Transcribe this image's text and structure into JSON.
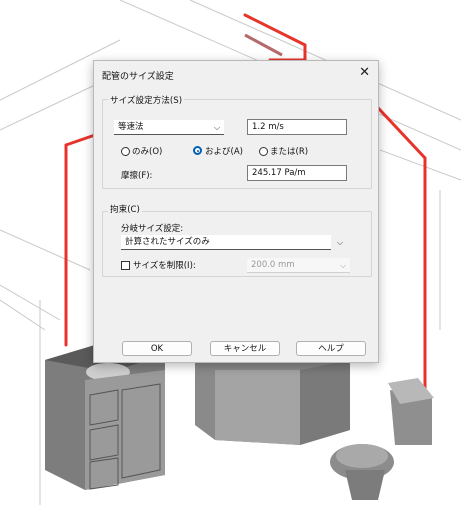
{
  "dialog": {
    "title": "配管のサイズ設定",
    "close_icon": "close-icon"
  },
  "sizing": {
    "legend": "サイズ設定方法(S)",
    "method_value": "等速法",
    "velocity_value": "1.2 m/s",
    "radio_only": "のみ(O)",
    "radio_and": "および(A)",
    "radio_or": "または(R)",
    "selected_radio": "and",
    "friction_label": "摩擦(F):",
    "friction_value": "245.17 Pa/m"
  },
  "constraints": {
    "legend": "拘束(C)",
    "branch_label": "分岐サイズ設定:",
    "branch_value": "計算されたサイズのみ",
    "restrict_label": "サイズを制限(I):",
    "restrict_checked": false,
    "restrict_value": "200.0 mm"
  },
  "buttons": {
    "ok": "OK",
    "cancel": "キャンセル",
    "help": "ヘルプ"
  },
  "colors": {
    "pipe": "#e8332b",
    "accent": "#005fb8"
  }
}
